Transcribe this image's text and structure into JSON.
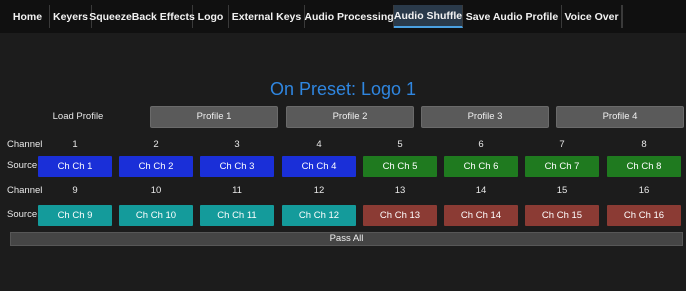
{
  "tabs": [
    {
      "label": "Home"
    },
    {
      "label": "Keyers"
    },
    {
      "label": "SqueezeBack Effects"
    },
    {
      "label": "Logo"
    },
    {
      "label": "External Keys"
    },
    {
      "label": "Audio Processing"
    },
    {
      "label": "Audio Shuffle",
      "active": true
    },
    {
      "label": "Save Audio Profile"
    },
    {
      "label": "Voice Over"
    }
  ],
  "title": "On Preset: Logo 1",
  "load_profile_label": "Load Profile",
  "profiles": [
    "Profile 1",
    "Profile 2",
    "Profile 3",
    "Profile 4"
  ],
  "channel_label": "Channel",
  "source_label": "Source",
  "rows": [
    {
      "channels": [
        "1",
        "2",
        "3",
        "4",
        "5",
        "6",
        "7",
        "8"
      ],
      "sources": [
        "Ch Ch 1",
        "Ch Ch 2",
        "Ch Ch 3",
        "Ch Ch 4",
        "Ch Ch 5",
        "Ch Ch 6",
        "Ch Ch 7",
        "Ch Ch 8"
      ]
    },
    {
      "channels": [
        "9",
        "10",
        "11",
        "12",
        "13",
        "14",
        "15",
        "16"
      ],
      "sources": [
        "Ch Ch 9",
        "Ch Ch 10",
        "Ch Ch 11",
        "Ch Ch 12",
        "Ch Ch 13",
        "Ch Ch 14",
        "Ch Ch 15",
        "Ch Ch 16"
      ]
    }
  ],
  "pass_all_label": "Pass All",
  "colors": {
    "title": "#2f86e0",
    "source_blue": "#1a2fd8",
    "source_green": "#1f7a1f",
    "source_teal": "#149b9b",
    "source_red": "#8b3b34"
  }
}
